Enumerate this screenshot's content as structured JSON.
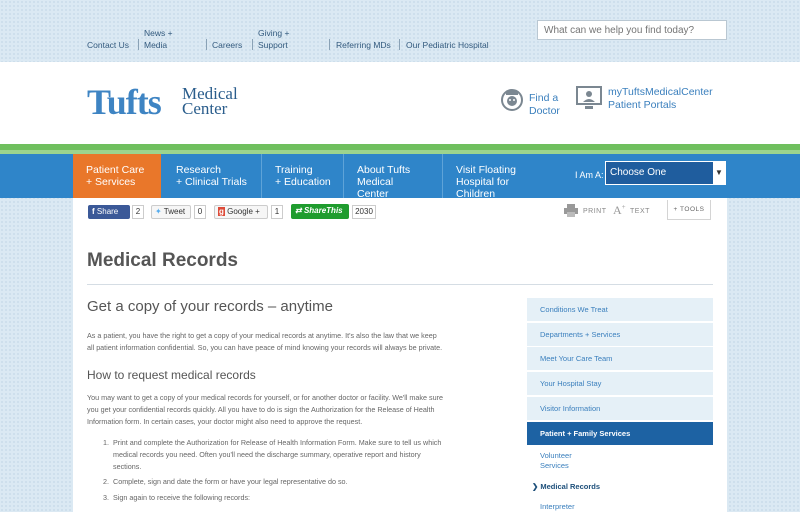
{
  "utility": {
    "links": [
      "Contact Us",
      "News +",
      "Media",
      "Careers",
      "Giving +",
      "Support",
      "Referring MDs",
      "Our Pediatric Hospital"
    ],
    "search_placeholder": "What can we help you find today?"
  },
  "header": {
    "logo_tufts": "Tufts",
    "logo_medical": "Medical",
    "logo_center": "Center",
    "find_doctor_1": "Find a",
    "find_doctor_2": "Doctor",
    "portal_1": "myTuftsMedicalCenter",
    "portal_2": "Patient Portals"
  },
  "nav": {
    "items": [
      {
        "line1": "Patient Care",
        "line2": "+ Services",
        "line3": ""
      },
      {
        "line1": "Research",
        "line2": "+ Clinical Trials",
        "line3": ""
      },
      {
        "line1": "Training",
        "line2": "+ Education",
        "line3": ""
      },
      {
        "line1": "About Tufts",
        "line2": "Medical",
        "line3": "Center"
      },
      {
        "line1": "Visit Floating",
        "line2": "Hospital for",
        "line3": "Children"
      }
    ],
    "iam_label": "I Am A:",
    "iam_value": "Choose One"
  },
  "social": {
    "share": "Share",
    "share_count": "2",
    "tweet": "Tweet",
    "tweet_count": "0",
    "google": "Google +",
    "google_count": "1",
    "sharethis": "ShareThis",
    "sharethis_count": "2030",
    "print": "PRINT",
    "text": "TEXT",
    "tools": "+ TOOLS"
  },
  "page": {
    "title": "Medical Records",
    "h2": "Get a copy of your records – anytime",
    "p1a": "As a patient, you have the right to get a copy of your medical records at anytime. It's also the law that we keep",
    "p1b": "all patient information confidential. So, you can have peace of mind knowing your records will always be private.",
    "h3": "How to request medical records",
    "p2a": "You may want to get a copy of your medical records for yourself, or for another doctor or facility. We'll make sure",
    "p2b": "you get your confidential records quickly. All you have to do is sign the Authorization for the Release of Health",
    "p2c": "Information form. In certain cases, your doctor might also need to approve the request.",
    "steps": [
      {
        "num": "1.",
        "lines": [
          "Print and complete the Authorization for Release of Health Information Form. Make sure to tell us which",
          "medical records you need. Often you'll need the discharge summary, operative report and history",
          "sections."
        ]
      },
      {
        "num": "2.",
        "lines": [
          "Complete, sign and date the form or have your legal representative do so."
        ]
      },
      {
        "num": "3.",
        "lines": [
          "Sign again to receive the following records:"
        ]
      }
    ]
  },
  "sidenav": {
    "items": [
      "Conditions We Treat",
      "Departments + Services",
      "Meet Your Care Team",
      "Your Hospital Stay",
      "Visitor Information",
      "Patient + Family Services"
    ],
    "sub_volunteer_1": "Volunteer",
    "sub_volunteer_2": "Services",
    "sub_current_arrow": "❯",
    "sub_current": "Medical Records",
    "sub_interpreter": "Interpreter"
  }
}
